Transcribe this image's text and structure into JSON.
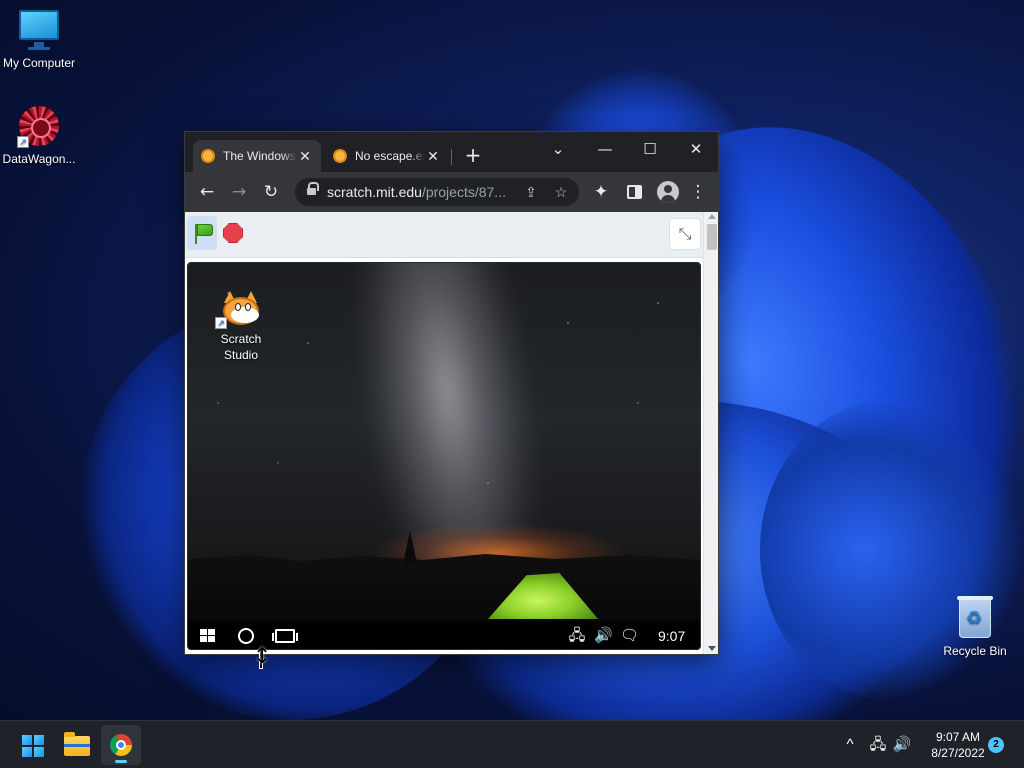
{
  "desktop": {
    "icons": [
      {
        "label": "My Computer",
        "icon": "monitor-icon"
      },
      {
        "label": "DataWagon...",
        "icon": "mandala-icon"
      },
      {
        "label": "Recycle Bin",
        "icon": "recycle-bin-icon"
      }
    ]
  },
  "browser": {
    "tabs": [
      {
        "title": "The Windows",
        "active": true,
        "close": "✕"
      },
      {
        "title": "No escape.exe",
        "active": false,
        "close": "✕"
      }
    ],
    "new_tab": "+",
    "window_controls": {
      "dropdown": "⌄",
      "minimize": "—",
      "maximize": "☐",
      "close": "✕"
    },
    "nav": {
      "back": "←",
      "forward": "→",
      "reload": "↻",
      "share": "⇪",
      "bookmark": "☆",
      "extensions": "✦",
      "menu": "⋮"
    },
    "omnibox": {
      "host": "scratch.mit.edu",
      "path": "/projects/87..."
    }
  },
  "scratch": {
    "fullscreen_icon": "⤡",
    "vm_desktop": {
      "icon_label_line1": "Scratch",
      "icon_label_line2": "Studio"
    },
    "vm_taskbar": {
      "clock": "9:07",
      "tray_icons": {
        "network": "🖧",
        "volume": "🔊",
        "action_center": "🗨"
      }
    }
  },
  "taskbar": {
    "apps": [
      {
        "name": "Start",
        "active": false
      },
      {
        "name": "File Explorer",
        "active": false
      },
      {
        "name": "Google Chrome",
        "active": true
      }
    ],
    "tray": {
      "chevron": "^",
      "network": "🖧",
      "volume": "🔊"
    },
    "time": "9:07 AM",
    "date": "8/27/2022",
    "notification_count": "2"
  },
  "colors": {
    "accent": "#60cdff",
    "chrome_frame": "#202124",
    "chrome_toolbar": "#35363a",
    "scratch_bar": "#e9eef2",
    "stop_red": "#e6404c",
    "flag_green": "#4caf2a"
  }
}
